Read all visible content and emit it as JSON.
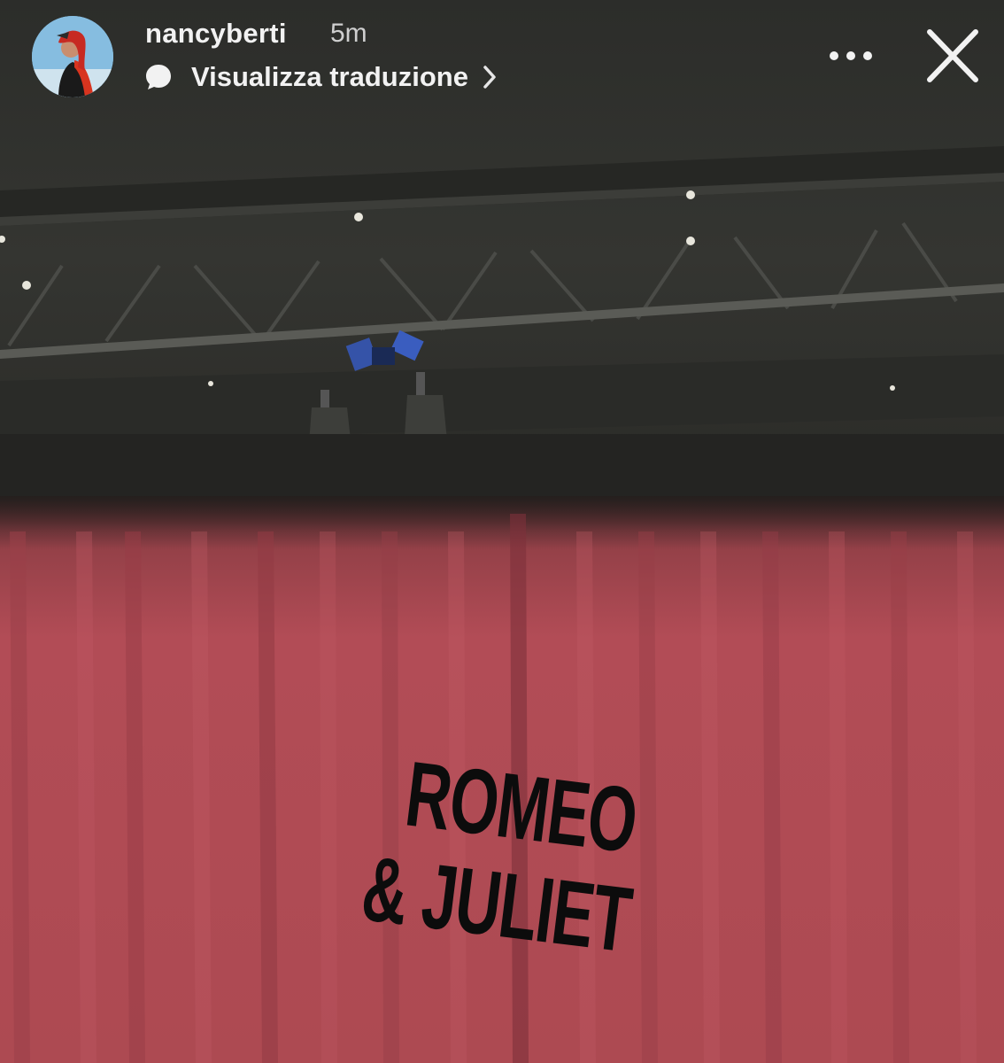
{
  "story": {
    "username": "nancyberti",
    "timestamp": "5m",
    "translation_label": "Visualizza traduzione"
  },
  "sticker": {
    "line1": "ROMEO",
    "line2": "& JULIET"
  },
  "icons": {
    "translate": "speech-bubble-icon",
    "chevron": "chevron-right-icon",
    "more": "more-options-icon",
    "close": "close-icon"
  },
  "colors": {
    "curtain": "#b04a54",
    "ceiling": "#2f302d",
    "header_text": "#f2f2f2"
  }
}
